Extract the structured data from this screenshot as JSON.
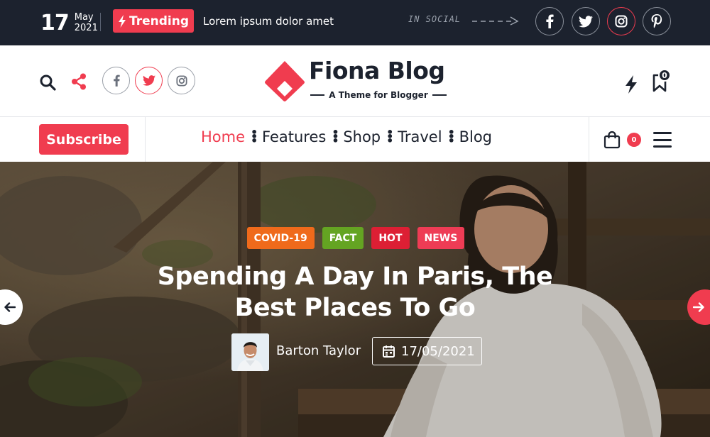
{
  "topbar": {
    "date_day": "17",
    "date_month": "May",
    "date_year": "2021",
    "trending_label": "Trending",
    "headline": "Lorem ipsum dolor amet",
    "in_social_label": "IN SOCIAL",
    "social": [
      {
        "icon": "facebook-icon",
        "glyph": "f",
        "active": false
      },
      {
        "icon": "twitter-icon",
        "glyph": "t",
        "active": false
      },
      {
        "icon": "instagram-icon",
        "glyph": "i",
        "active": true
      },
      {
        "icon": "pinterest-icon",
        "glyph": "p",
        "active": false
      }
    ]
  },
  "header": {
    "logo_title": "Fiona Blog",
    "logo_tagline": "A Theme for Blogger",
    "bookmark_count": "0"
  },
  "nav": {
    "subscribe_label": "Subscribe",
    "menu": [
      {
        "label": "Home",
        "active": true
      },
      {
        "label": "Features",
        "active": false
      },
      {
        "label": "Shop",
        "active": false
      },
      {
        "label": "Travel",
        "active": false
      },
      {
        "label": "Blog",
        "active": false
      }
    ],
    "cart_count": "0"
  },
  "hero": {
    "tags": [
      {
        "label": "COVID-19",
        "color": "#ef6a1b"
      },
      {
        "label": "FACT",
        "color": "#64a422"
      },
      {
        "label": "HOT",
        "color": "#dd1f34"
      },
      {
        "label": "NEWS",
        "color": "#ee3c55"
      }
    ],
    "title": "Spending A Day In Paris, The Best Places To Go",
    "author": "Barton Taylor",
    "date": "17/05/2021"
  },
  "colors": {
    "accent": "#f03c4f",
    "dark": "#1c222e"
  }
}
